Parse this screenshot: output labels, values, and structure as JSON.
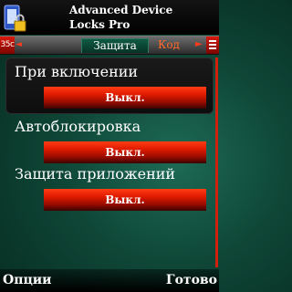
{
  "header": {
    "title_line1": "Advanced Device",
    "title_line2": "Locks Pro"
  },
  "status": {
    "battery_level": "35c"
  },
  "tabs": [
    {
      "label": "Защита",
      "active": true
    },
    {
      "label": "Код",
      "active": false
    }
  ],
  "settings": [
    {
      "label": "При включении",
      "value": "Выкл.",
      "selected": true
    },
    {
      "label": "Автоблокировка",
      "value": "Выкл.",
      "selected": false
    },
    {
      "label": "Защита приложений",
      "value": "Выкл.",
      "selected": false
    }
  ],
  "softkeys": {
    "left": "Опции",
    "right": "Готово"
  },
  "colors": {
    "accent": "#e01b00",
    "background": "#0f4737",
    "tab_inactive_text": "#ff6a2a"
  },
  "icons": [
    "phone-lock-icon",
    "padlock-icon",
    "scroll-left-icon",
    "scroll-right-icon",
    "signal-icon"
  ]
}
